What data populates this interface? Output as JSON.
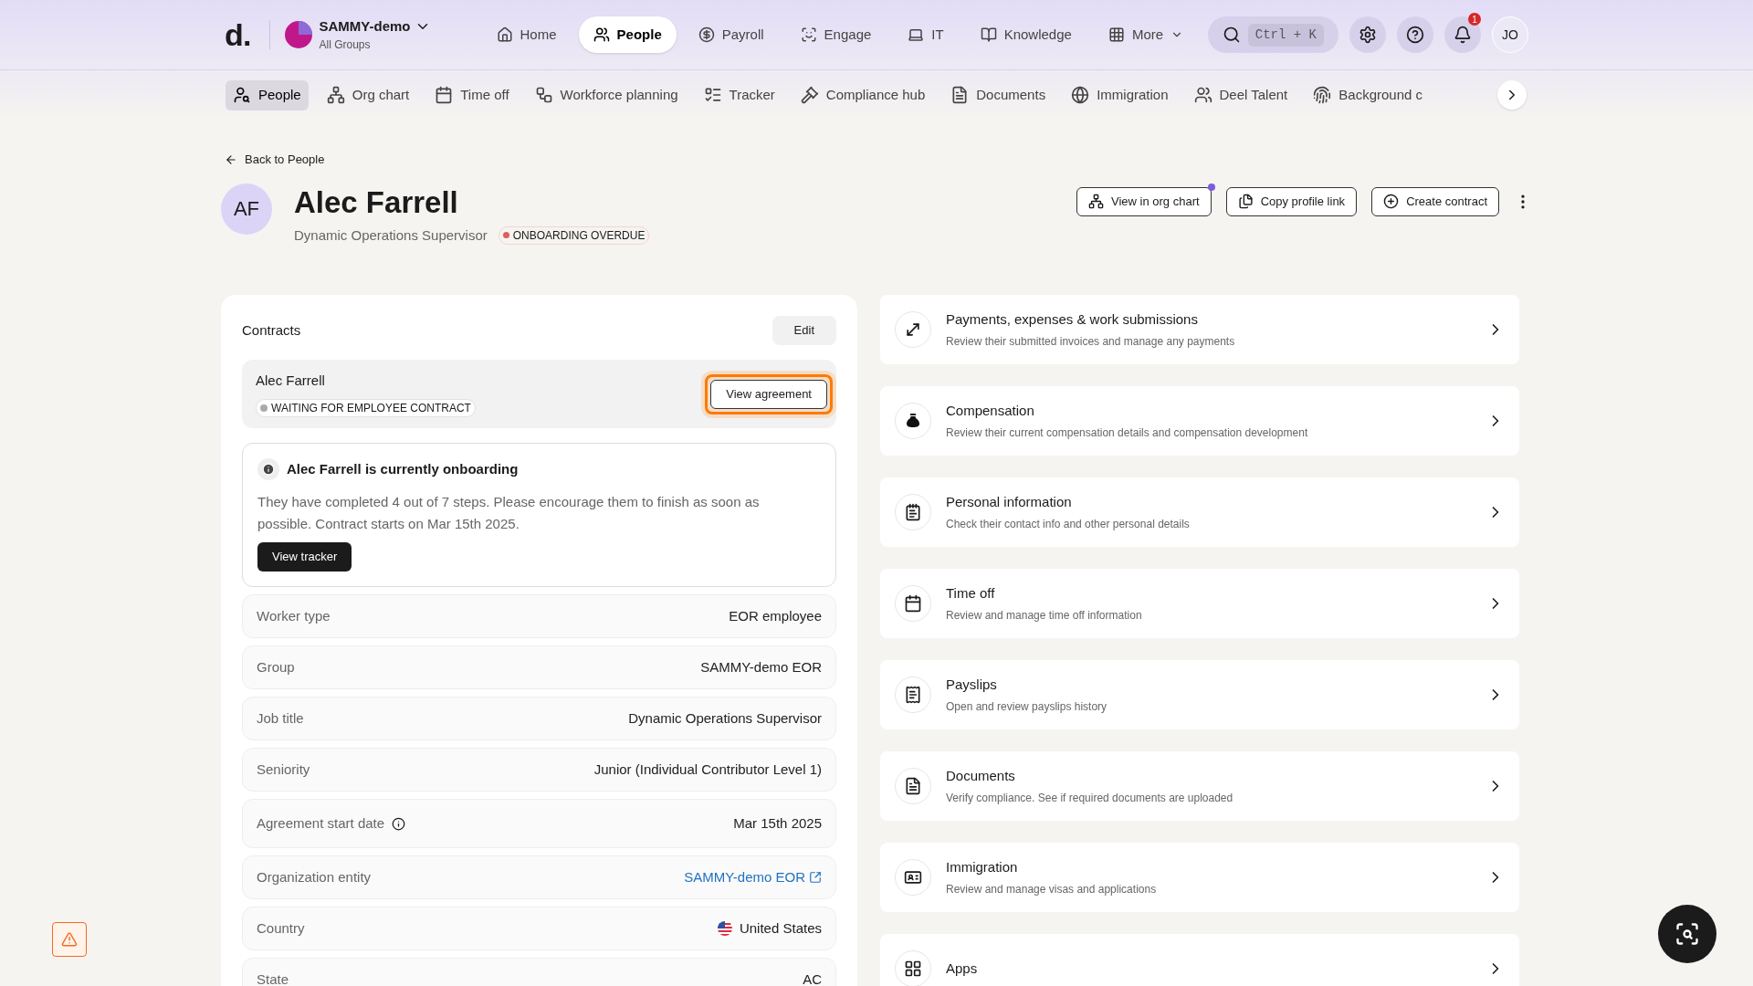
{
  "top_nav": {
    "logo": "d.",
    "org": {
      "name": "SAMMY-demo",
      "subtitle": "All Groups"
    },
    "items": [
      {
        "label": "Home",
        "selected": false
      },
      {
        "label": "People",
        "selected": true
      },
      {
        "label": "Payroll",
        "selected": false
      },
      {
        "label": "Engage",
        "selected": false
      },
      {
        "label": "IT",
        "selected": false
      },
      {
        "label": "Knowledge",
        "selected": false
      },
      {
        "label": "More",
        "selected": false
      }
    ],
    "search_shortcut": "Ctrl + K",
    "notification_count": "1",
    "avatar": "JO"
  },
  "sub_nav": [
    {
      "label": "People",
      "selected": true
    },
    {
      "label": "Org chart",
      "selected": false
    },
    {
      "label": "Time off",
      "selected": false
    },
    {
      "label": "Workforce planning",
      "selected": false
    },
    {
      "label": "Tracker",
      "selected": false
    },
    {
      "label": "Compliance hub",
      "selected": false
    },
    {
      "label": "Documents",
      "selected": false
    },
    {
      "label": "Immigration",
      "selected": false
    },
    {
      "label": "Deel Talent",
      "selected": false
    },
    {
      "label": "Background c",
      "selected": false
    }
  ],
  "back_link": "Back to People",
  "profile": {
    "initials": "AF",
    "name": "Alec Farrell",
    "title": "Dynamic Operations Supervisor",
    "status": "ONBOARDING OVERDUE"
  },
  "actions": [
    "View in org chart",
    "Copy profile link",
    "Create contract"
  ],
  "contracts": {
    "title": "Contracts",
    "edit": "Edit",
    "contract": {
      "name": "Alec Farrell",
      "status": "WAITING FOR EMPLOYEE CONTRACT",
      "button": "View agreement",
      "highlighted": true
    },
    "onboarding": {
      "title": "Alec Farrell is currently onboarding",
      "text": "They have completed 4 out of 7 steps. Please encourage them to finish as soon as possible. Contract starts on Mar 15th 2025.",
      "button": "View tracker"
    }
  },
  "details": [
    {
      "label": "Worker type",
      "value": "EOR employee",
      "kind": "text"
    },
    {
      "label": "Group",
      "value": "SAMMY-demo EOR",
      "kind": "text"
    },
    {
      "label": "Job title",
      "value": "Dynamic Operations Supervisor",
      "kind": "text"
    },
    {
      "label": "Seniority",
      "value": "Junior (Individual Contributor Level 1)",
      "kind": "text"
    },
    {
      "label": "Agreement start date",
      "value": "Mar 15th 2025",
      "kind": "info"
    },
    {
      "label": "Organization entity",
      "value": "SAMMY-demo EOR",
      "kind": "link"
    },
    {
      "label": "Country",
      "value": "United States",
      "kind": "country"
    },
    {
      "label": "State",
      "value": "AC",
      "kind": "text"
    }
  ],
  "sections": [
    {
      "title": "Payments, expenses & work submissions",
      "description": "Review their submitted invoices and manage any payments"
    },
    {
      "title": "Compensation",
      "description": "Review their current compensation details and compensation development"
    },
    {
      "title": "Personal information",
      "description": "Check their contact info and other personal details"
    },
    {
      "title": "Time off",
      "description": "Review and manage time off information"
    },
    {
      "title": "Payslips",
      "description": "Open and review payslips history"
    },
    {
      "title": "Documents",
      "description": "Verify compliance. See if required documents are uploaded"
    },
    {
      "title": "Immigration",
      "description": "Review and manage visas and applications"
    },
    {
      "title": "Apps"
    }
  ]
}
